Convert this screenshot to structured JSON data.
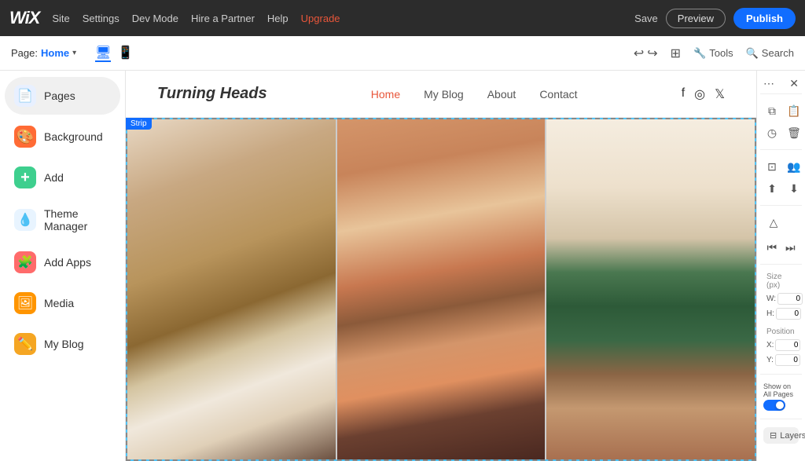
{
  "topbar": {
    "logo": "WiX",
    "nav_items": [
      "Site",
      "Settings",
      "Dev Mode",
      "Hire a Partner",
      "Help"
    ],
    "upgrade_label": "Upgrade",
    "save_label": "Save",
    "preview_label": "Preview",
    "publish_label": "Publish"
  },
  "secondbar": {
    "page_label": "Page:",
    "page_name": "Home",
    "tools_label": "Tools",
    "search_label": "Search"
  },
  "sidebar": {
    "items": [
      {
        "id": "pages",
        "label": "Pages",
        "icon": "📄"
      },
      {
        "id": "background",
        "label": "Background",
        "icon": "🎨"
      },
      {
        "id": "add",
        "label": "Add",
        "icon": "➕"
      },
      {
        "id": "theme-manager",
        "label": "Theme Manager",
        "icon": "🎨"
      },
      {
        "id": "add-apps",
        "label": "Add Apps",
        "icon": "🧩"
      },
      {
        "id": "media",
        "label": "Media",
        "icon": "🖼"
      },
      {
        "id": "my-blog",
        "label": "My Blog",
        "icon": "✏️"
      }
    ]
  },
  "site": {
    "logo": "Turning Heads",
    "nav_links": [
      {
        "label": "Home",
        "active": true
      },
      {
        "label": "My Blog",
        "active": false
      },
      {
        "label": "About",
        "active": false
      },
      {
        "label": "Contact",
        "active": false
      }
    ],
    "strip_label": "Strip",
    "page_heading": "Turning Heads"
  },
  "right_panel": {
    "close_label": "✕",
    "dots_label": "⋮",
    "size_label": "Size (px)",
    "w_label": "W:",
    "h_label": "H:",
    "w_value": "0",
    "h_value": "0",
    "position_label": "Position",
    "x_label": "X:",
    "y_label": "Y:",
    "x_value": "0",
    "y_value": "0",
    "show_all_pages_label": "Show on All Pages",
    "layers_label": "Layers"
  }
}
